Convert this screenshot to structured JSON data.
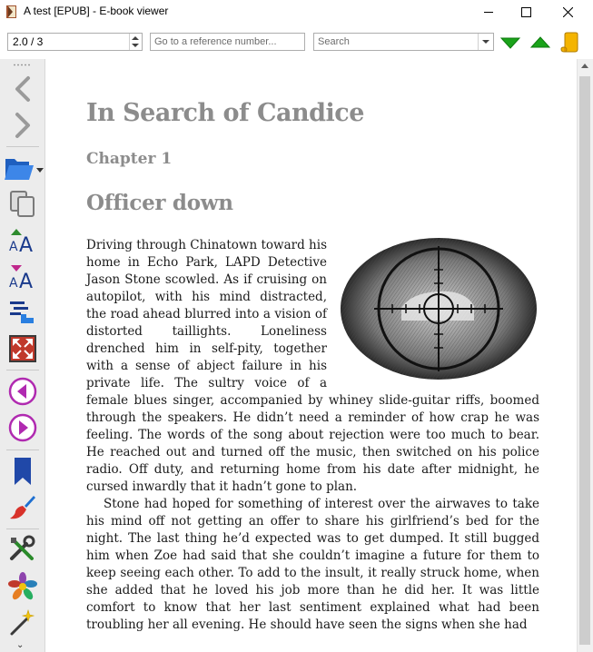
{
  "window": {
    "title": "A test [EPUB] - E-book viewer"
  },
  "toolbar": {
    "position_value": "2.0 / 3",
    "reference_placeholder": "Go to a reference number...",
    "search_placeholder": "Search"
  },
  "sidebar": {
    "items": [
      {
        "name": "back",
        "icon": "arrow-left-icon"
      },
      {
        "name": "forward",
        "icon": "arrow-right-icon"
      },
      {
        "name": "open-ebook",
        "icon": "folder-open-icon"
      },
      {
        "name": "copy",
        "icon": "copy-icon"
      },
      {
        "name": "font-larger",
        "icon": "font-larger-icon"
      },
      {
        "name": "font-smaller",
        "icon": "font-smaller-icon"
      },
      {
        "name": "toc",
        "icon": "table-of-contents-icon"
      },
      {
        "name": "fullscreen",
        "icon": "fullscreen-icon"
      },
      {
        "name": "previous-page",
        "icon": "previous-circle-icon"
      },
      {
        "name": "next-page",
        "icon": "next-circle-icon"
      },
      {
        "name": "bookmark",
        "icon": "bookmark-icon"
      },
      {
        "name": "theme",
        "icon": "paintbrush-icon"
      },
      {
        "name": "preferences",
        "icon": "tools-icon"
      },
      {
        "name": "metadata",
        "icon": "calibre-flower-icon"
      },
      {
        "name": "magic",
        "icon": "magic-wand-icon"
      }
    ]
  },
  "content": {
    "book_title": "In Search of Candice",
    "chapter": "Chapter 1",
    "section": "Officer down",
    "paragraphs": [
      "Driving through Chinatown toward his home in Echo Park, LAPD Detective Jason Stone scowled. As if cruising on autopilot, with his mind distracted, the road ahead blurred into a vision of distorted taillights. Loneliness drenched him in self-pity, together with a sense of abject failure in his private life. The sultry voice of a female blues singer, accompanied by whiney slide-guitar riffs, boomed through the speakers. He didn’t need a reminder of how crap he was feeling. The words of the song about rejection were too much to bear. He reached out and turned off the music, then switched on his police radio. Off duty, and returning home from his date after midnight, he cursed inwardly that it hadn’t gone to plan.",
      "Stone had hoped for something of interest over the airwaves to take his mind off not getting an offer to share his girlfriend’s bed for the night. The last thing he’d expected was to get dumped. It still bugged him when Zoe had said that she couldn’t imagine a future for them to keep seeing each other. To add to the insult, it really struck home, when she added that he loved his job more than he did her. It was little comfort to know that her last sentiment explained what had been troubling her all evening. He should have seen the signs when she had"
    ]
  },
  "colors": {
    "heading": "#8c8c8c",
    "nav_green": "#1aa31a",
    "sidebar_bg": "#ececec"
  }
}
